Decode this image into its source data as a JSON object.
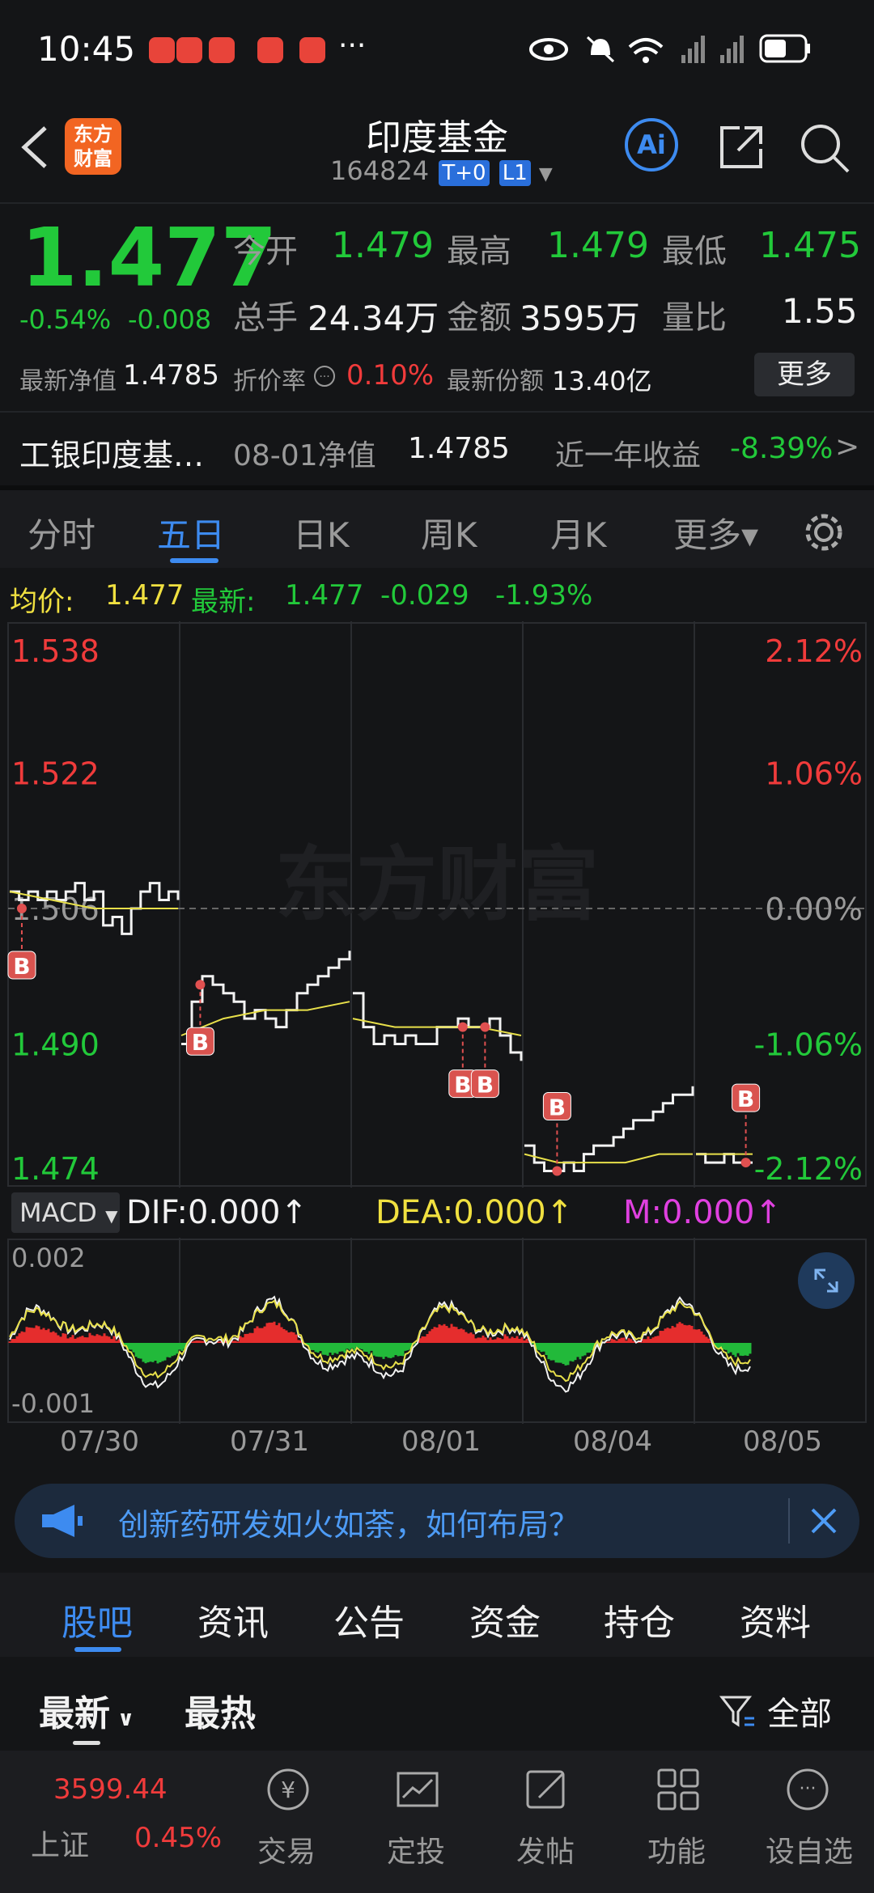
{
  "status": {
    "time": "10:45",
    "more": "···"
  },
  "header": {
    "title": "印度基金",
    "code": "164824",
    "tag1": "T+0",
    "tag2": "L1",
    "logo": "东方财富",
    "ai": "Ai"
  },
  "quote": {
    "price": "1.477",
    "change_pct": "-0.54%",
    "change": "-0.008",
    "open_label": "今开",
    "open": "1.479",
    "high_label": "最高",
    "high": "1.479",
    "low_label": "最低",
    "low": "1.475",
    "volume_label": "总手",
    "volume": "24.34万",
    "amount_label": "金额",
    "amount": "3595万",
    "ratio_label": "量比",
    "ratio": "1.55",
    "nav_label": "最新净值",
    "nav": "1.4785",
    "discount_label": "折价率",
    "discount": "0.10%",
    "shares_label": "最新份额",
    "shares": "13.40亿",
    "more_btn": "更多"
  },
  "fund": {
    "name": "工银印度基…",
    "nav_date_label": "08-01净值",
    "nav_value": "1.4785",
    "yearly_label": "近一年收益",
    "yearly_value": "-8.39%",
    "arrow": ">"
  },
  "chart_tabs": [
    "分时",
    "五日",
    "日K",
    "周K",
    "月K",
    "更多▾"
  ],
  "chart_info": {
    "avg_label": "均价:",
    "avg": "1.477",
    "latest_label": "最新:",
    "latest": "1.477",
    "chg": "-0.029",
    "chg_pct": "-1.93%"
  },
  "macd": {
    "selector": "MACD",
    "dif": "DIF:0.000↑",
    "dea": "DEA:0.000↑",
    "m": "M:0.000↑",
    "ymax": "0.002",
    "ymin": "-0.001"
  },
  "chart_data": {
    "type": "line",
    "title": "",
    "x": [
      "07/30",
      "07/31",
      "08/01",
      "08/04",
      "08/05"
    ],
    "y_left_ticks": [
      "1.538",
      "1.522",
      "1.506",
      "1.490",
      "1.474"
    ],
    "y_right_ticks": [
      "2.12%",
      "1.06%",
      "0.00%",
      "-1.06%",
      "-2.12%"
    ],
    "ylim": [
      1.474,
      1.538
    ],
    "reference": 1.506,
    "watermark": "东方财富",
    "series": [
      {
        "day": "07/30",
        "values": [
          1.508,
          1.507,
          1.508,
          1.507,
          1.508,
          1.507,
          1.508,
          1.509,
          1.507,
          1.508,
          1.504,
          1.505,
          1.503,
          1.506,
          1.508,
          1.509,
          1.507,
          1.508,
          1.507
        ]
      },
      {
        "day": "07/31",
        "values": [
          1.49,
          1.495,
          1.498,
          1.497,
          1.496,
          1.495,
          1.493,
          1.494,
          1.493,
          1.492,
          1.494,
          1.496,
          1.497,
          1.498,
          1.499,
          1.5,
          1.501
        ]
      },
      {
        "day": "08/01",
        "values": [
          1.496,
          1.492,
          1.49,
          1.491,
          1.49,
          1.491,
          1.49,
          1.49,
          1.492,
          1.492,
          1.493,
          1.492,
          1.492,
          1.493,
          1.491,
          1.489,
          1.488
        ]
      },
      {
        "day": "08/04",
        "values": [
          1.478,
          1.476,
          1.475,
          1.475,
          1.476,
          1.475,
          1.477,
          1.478,
          1.478,
          1.479,
          1.48,
          1.481,
          1.481,
          1.482,
          1.483,
          1.484,
          1.484,
          1.485
        ]
      },
      {
        "day": "08/05",
        "values": [
          1.477,
          1.476,
          1.476,
          1.477,
          1.476,
          1.476,
          1.476
        ]
      }
    ],
    "avg_series": [
      {
        "day": "07/30",
        "values": [
          1.508,
          1.507,
          1.506,
          1.506,
          1.506
        ]
      },
      {
        "day": "07/31",
        "values": [
          1.491,
          1.493,
          1.494,
          1.494,
          1.495
        ]
      },
      {
        "day": "08/01",
        "values": [
          1.493,
          1.492,
          1.492,
          1.492,
          1.491
        ]
      },
      {
        "day": "08/04",
        "values": [
          1.477,
          1.476,
          1.476,
          1.476,
          1.477,
          1.477
        ]
      },
      {
        "day": "08/05",
        "values": [
          1.477,
          1.477,
          1.477
        ]
      }
    ],
    "markers": [
      {
        "day": "07/30",
        "label": "B",
        "price": 1.506
      },
      {
        "day": "07/31",
        "label": "B",
        "price": 1.497
      },
      {
        "day": "08/01",
        "label": "B",
        "price": 1.492
      },
      {
        "day": "08/01",
        "label": "B",
        "price": 1.492
      },
      {
        "day": "08/04",
        "label": "B",
        "price": 1.475
      },
      {
        "day": "08/05",
        "label": "B",
        "price": 1.476
      }
    ]
  },
  "banner": {
    "text": "创新药研发如火如荼，如何布局？"
  },
  "section_tabs": [
    "股吧",
    "资讯",
    "公告",
    "资金",
    "持仓",
    "资料"
  ],
  "filter": {
    "latest": "最新",
    "hot": "最热",
    "all": "全部"
  },
  "bottom": {
    "index_value": "3599.44",
    "index_name": "上证",
    "index_pct": "0.45%",
    "items": [
      "交易",
      "定投",
      "发帖",
      "功能",
      "设自选"
    ]
  },
  "colors": {
    "up": "#f03b3b",
    "down": "#22c93a",
    "accent": "#3d8bf0",
    "avg": "#e8e04a"
  }
}
